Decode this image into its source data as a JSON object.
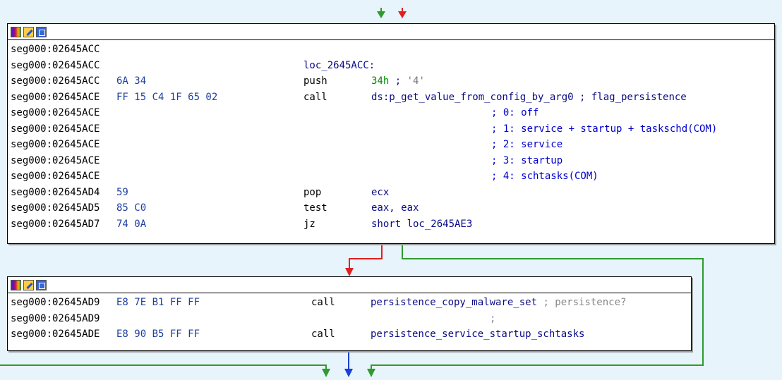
{
  "node1": {
    "lines": [
      {
        "addr": "seg000:02645ACC",
        "bytes": "",
        "label": "",
        "mn": "",
        "op": "",
        "cmt": ""
      },
      {
        "addr": "seg000:02645ACC",
        "bytes": "",
        "label": "loc_2645ACC:",
        "mn": "",
        "op": "",
        "cmt": ""
      },
      {
        "addr": "seg000:02645ACC",
        "bytes": "6A 34",
        "label": "",
        "mn": "push",
        "op_imm": "34h",
        "op_sep": " ; ",
        "op_str": "'4'"
      },
      {
        "addr": "seg000:02645ACE",
        "bytes": "FF 15 C4 1F 65 02",
        "label": "",
        "mn": "call",
        "op_sym": "ds:p_get_value_from_config_by_arg0",
        "cmt": " ; flag_persistence"
      },
      {
        "addr": "seg000:02645ACE",
        "cmt_only": "; 0: off"
      },
      {
        "addr": "seg000:02645ACE",
        "cmt_only": "; 1: service + startup + taskschd(COM)"
      },
      {
        "addr": "seg000:02645ACE",
        "cmt_only": "; 2: service"
      },
      {
        "addr": "seg000:02645ACE",
        "cmt_only": "; 3: startup"
      },
      {
        "addr": "seg000:02645ACE",
        "cmt_only": "; 4: schtasks(COM)"
      },
      {
        "addr": "seg000:02645AD4",
        "bytes": "59",
        "mn": "pop",
        "op": "ecx"
      },
      {
        "addr": "seg000:02645AD5",
        "bytes": "85 C0",
        "mn": "test",
        "op": "eax, eax"
      },
      {
        "addr": "seg000:02645AD7",
        "bytes": "74 0A",
        "mn": "jz",
        "op": "short loc_2645AE3"
      }
    ]
  },
  "node2": {
    "lines": [
      {
        "addr": "seg000:02645AD9",
        "bytes": "E8 7E B1 FF FF",
        "mn": "call",
        "op_sym": "persistence_copy_malware_set",
        "cmt_gray": " ; persistence?"
      },
      {
        "addr": "seg000:02645AD9",
        "cmt_gray_only": ";"
      },
      {
        "addr": "seg000:02645ADE",
        "bytes": "E8 90 B5 FF FF",
        "mn": "call",
        "op_sym": "persistence_service_startup_schtasks"
      }
    ]
  },
  "colors": {
    "edge_true": "#2e9b2e",
    "edge_false": "#e02020",
    "edge_flow": "#1a3fd6",
    "background": "#e8f4fb"
  }
}
